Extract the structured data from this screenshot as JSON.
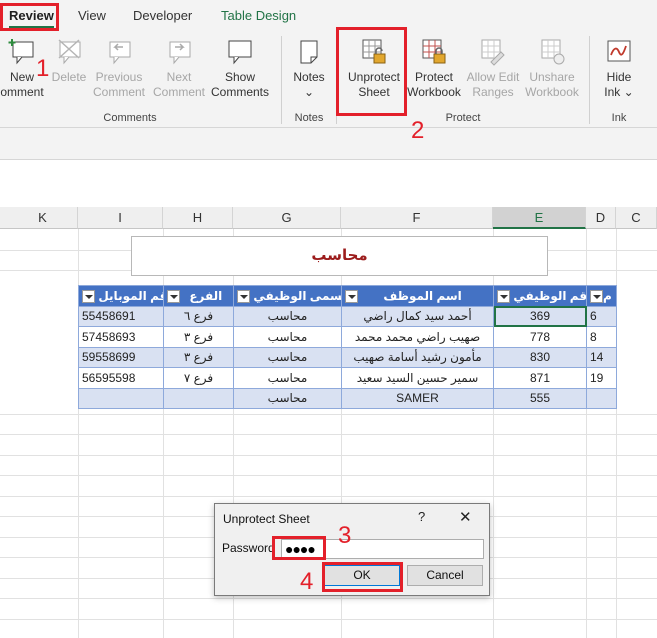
{
  "ribbon": {
    "tabs": [
      "Review",
      "View",
      "Developer",
      "Table Design"
    ],
    "buttons": {
      "new_comment": [
        "New",
        "omment"
      ],
      "delete": [
        "Delete"
      ],
      "previous_comment": [
        "Previous",
        "Comment"
      ],
      "next_comment": [
        "Next",
        "Comment"
      ],
      "show_comments": [
        "Show",
        "Comments"
      ],
      "notes": [
        "Notes",
        "⌄"
      ],
      "unprotect_sheet": [
        "Unprotect",
        "Sheet"
      ],
      "protect_workbook": [
        "Protect",
        "Workbook"
      ],
      "allow_edit_ranges": [
        "Allow Edit",
        "Ranges"
      ],
      "unshare_workbook": [
        "Unshare",
        "Workbook"
      ],
      "hide_ink": [
        "Hide",
        "Ink ⌄"
      ]
    },
    "groups": [
      "Comments",
      "Notes",
      "Protect",
      "Ink"
    ]
  },
  "columns": [
    "K",
    "I",
    "H",
    "G",
    "F",
    "E",
    "D",
    "C"
  ],
  "sheet": {
    "title": "محاسب",
    "headers": {
      "mobile": "رقم الموبايل",
      "branch": "الفرع",
      "job_title": "المسمى الوظيفي",
      "employee_name": "اسم الموظف",
      "employee_id": "الرقم الوظيفي",
      "serial": "م"
    },
    "rows": [
      {
        "mobile": "55458691",
        "branch": "فرع ٦",
        "job_title": "محاسب",
        "employee_name": "أحمد سيد كمال راضي",
        "employee_id": "369",
        "serial": "6"
      },
      {
        "mobile": "57458693",
        "branch": "فرع ٣",
        "job_title": "محاسب",
        "employee_name": "صهيب راضي محمد محمد",
        "employee_id": "778",
        "serial": "8"
      },
      {
        "mobile": "59558699",
        "branch": "فرع ٣",
        "job_title": "محاسب",
        "employee_name": "مأمون رشيد أسامة صهيب",
        "employee_id": "830",
        "serial": "14"
      },
      {
        "mobile": "56595598",
        "branch": "فرع ٧",
        "job_title": "محاسب",
        "employee_name": "سمير حسين السيد سعيد",
        "employee_id": "871",
        "serial": "19"
      },
      {
        "mobile": "",
        "branch": "",
        "job_title": "محاسب",
        "employee_name": "SAMER",
        "employee_id": "555",
        "serial": ""
      }
    ]
  },
  "dialog": {
    "title": "Unprotect Sheet",
    "help": "?",
    "close": "✕",
    "password_label": "Password",
    "password_value": "●●●●",
    "ok_label": "OK",
    "cancel_label": "Cancel"
  },
  "annotations": [
    "1",
    "2",
    "3",
    "4"
  ],
  "colors": {
    "accent": "#217346",
    "header_blue": "#4472c4",
    "band": "#d9e1f2",
    "annotation_red": "#e3202a",
    "title_text": "#9c1c1c"
  }
}
